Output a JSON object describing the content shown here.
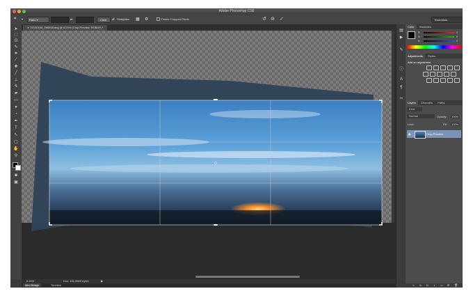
{
  "window": {
    "title": "Adobe Photoshop CS6"
  },
  "options_bar": {
    "ratio_select": "Ratio",
    "clear_label": "Clear",
    "straighten_label": "Straighten",
    "delete_cropped_label": "Delete Cropped Pixels",
    "workspace_select": "Essentials"
  },
  "document": {
    "tab_label": "20130108_095518.dng @ 8.24% (Crop Preview, RGB/8*) *"
  },
  "status": {
    "zoom": "8.24%",
    "doc_size": "Doc: 181.0M/0 bytes"
  },
  "bottom_tabs": [
    "Mini Bridge",
    "Timeline"
  ],
  "panels": {
    "color_tabs": [
      "Color",
      "Swatches"
    ],
    "color_sliders": [
      {
        "label": "R",
        "value": "0",
        "color": "#e03030"
      },
      {
        "label": "G",
        "value": "0",
        "color": "#30b030"
      },
      {
        "label": "B",
        "value": "0",
        "color": "#3050e0"
      }
    ],
    "adjust_tabs": [
      "Adjustments",
      "Styles"
    ],
    "adjust_hint": "Add an adjustment",
    "layers_tabs": [
      "Layers",
      "Channels",
      "Paths"
    ],
    "kind_filter": "Kind",
    "blend_mode": "Normal",
    "opacity_label": "Opacity:",
    "opacity_value": "100%",
    "lock_label": "Lock:",
    "fill_label": "Fill:",
    "fill_value": "100%",
    "layer_name": "Crop Preview"
  }
}
